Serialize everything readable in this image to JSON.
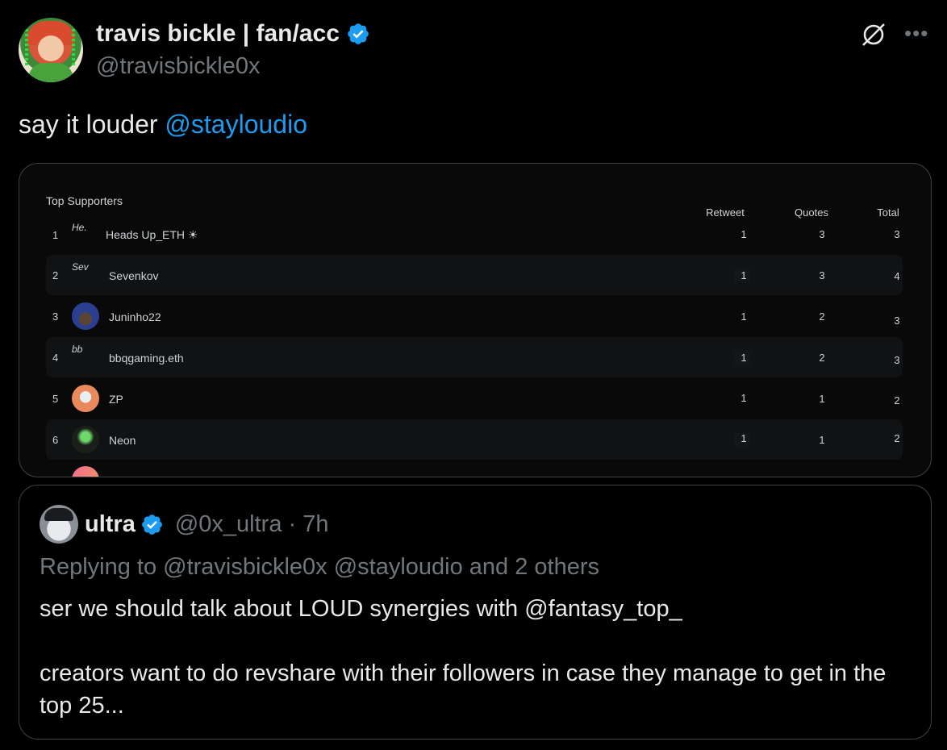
{
  "tweet": {
    "display_name": "travis bickle | fan/acc",
    "handle": "@travisbickle0x",
    "text_prefix": "say it louder ",
    "text_mention": "@stayloudio",
    "icons": [
      "verified-badge-icon",
      "grok-icon",
      "more-icon"
    ],
    "accent_color": "#1d9bf0"
  },
  "media": {
    "title": "Top Supporters",
    "columns": [
      "Retweet",
      "Quotes",
      "Total"
    ],
    "rows": [
      {
        "rank": "1",
        "avatar_alt": "He.",
        "name": "Heads Up_ETH ☀",
        "retweet": "1",
        "quotes": "3",
        "total": "3"
      },
      {
        "rank": "2",
        "avatar_alt": "Sev",
        "name": "Sevenkov",
        "retweet": "1",
        "quotes": "3",
        "total": "4"
      },
      {
        "rank": "3",
        "avatar_alt": "",
        "name": "Juninho22",
        "retweet": "1",
        "quotes": "2",
        "total": "3"
      },
      {
        "rank": "4",
        "avatar_alt": "bb",
        "name": "bbqgaming.eth",
        "retweet": "1",
        "quotes": "2",
        "total": "3"
      },
      {
        "rank": "5",
        "avatar_alt": "",
        "name": "ZP",
        "retweet": "1",
        "quotes": "1",
        "total": "2"
      },
      {
        "rank": "6",
        "avatar_alt": "",
        "name": "Neon",
        "retweet": "1",
        "quotes": "1",
        "total": "2"
      }
    ]
  },
  "quote": {
    "display_name": "ultra",
    "handle_time": "@0x_ultra · 7h",
    "replying": "Replying to @travisbickle0x @stayloudio and 2 others",
    "line1": "ser we should talk about LOUD synergies with @fantasy_top_",
    "line2": "creators want to do revshare with their followers in case they manage to get in the top 25..."
  }
}
